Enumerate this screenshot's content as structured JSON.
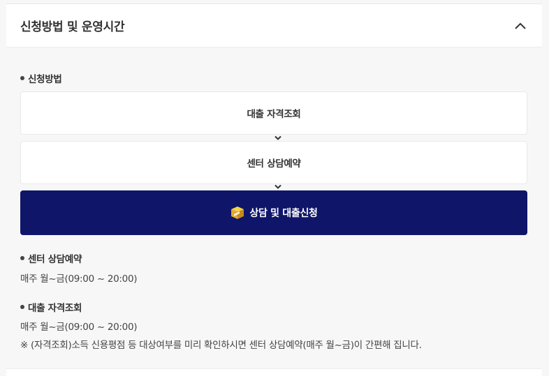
{
  "panel": {
    "title": "신청방법 및 운영시간",
    "collapse_icon": "chevron-up-icon"
  },
  "apply": {
    "heading": "신청방법",
    "steps": [
      "대출 자격조회",
      "센터 상담예약"
    ],
    "arrow_icon": "chevron-down-icon",
    "cta_label": "상담 및 대출신청",
    "cta_icon": "gift-box-icon",
    "cta_color": "#0f1569"
  },
  "hours": [
    {
      "heading": "센터 상담예약",
      "text": "매주 월~금(09:00 ~ 20:00)"
    },
    {
      "heading": "대출 자격조회",
      "text": "매주 월~금(09:00 ~ 20:00)"
    }
  ],
  "note": "※ (자격조회)소득 신용평점 등 대상여부를 미리 확인하시면 센터 상담예약(매주 월~금)이 간편해 집니다."
}
